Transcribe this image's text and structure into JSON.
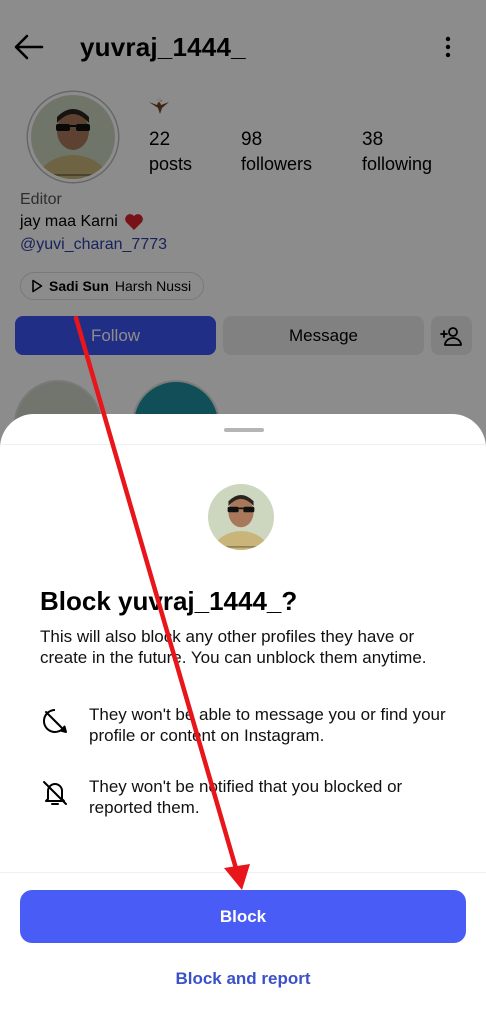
{
  "profile": {
    "username": "yuvraj_1444_",
    "stats": {
      "posts_count": "22",
      "posts_label": "posts",
      "followers_count": "98",
      "followers_label": "followers",
      "following_count": "38",
      "following_label": "following"
    },
    "category": "Editor",
    "bio": "jay maa Karni",
    "bio_link": "@yuvi_charan_7773",
    "music": {
      "song": "Sadi Sun",
      "artist": "Harsh Nussi"
    },
    "buttons": {
      "follow": "Follow",
      "message": "Message"
    }
  },
  "sheet": {
    "title": "Block yuvraj_1444_?",
    "description": "This will also block any other profiles they have or create in the future. You can unblock them anytime.",
    "items": [
      {
        "icon": "no-message-icon",
        "text": "They won't be able to message you or find your profile or content on Instagram."
      },
      {
        "icon": "bell-off-icon",
        "text": "They won't be notified that you blocked or reported them."
      }
    ],
    "block_label": "Block",
    "block_report_label": "Block and report"
  },
  "colors": {
    "accent": "#4a5cf6",
    "link": "#3b51c9",
    "annotation_arrow": "#e8161b"
  }
}
